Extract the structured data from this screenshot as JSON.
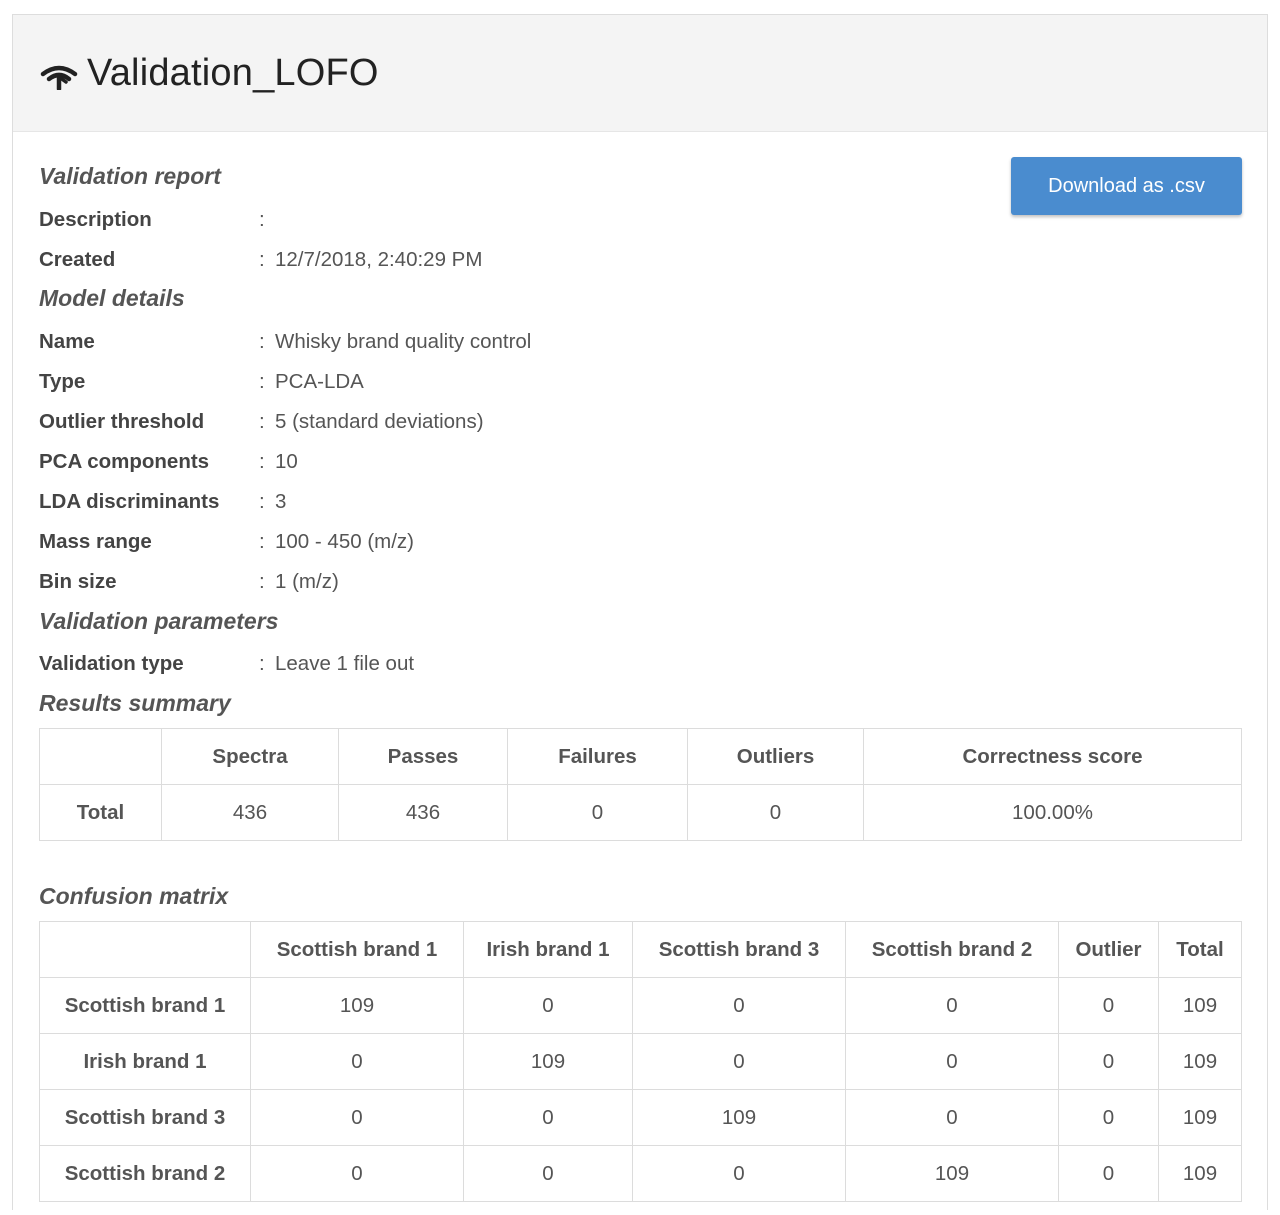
{
  "header": {
    "title": "Validation_LOFO",
    "icon": "wave-icon"
  },
  "actions": {
    "download_label": "Download as .csv",
    "download_color": "#4a8ccf"
  },
  "validation_report": {
    "heading": "Validation report",
    "description_label": "Description",
    "description_value": "",
    "created_label": "Created",
    "created_value": "12/7/2018, 2:40:29 PM"
  },
  "model_details": {
    "heading": "Model details",
    "rows": [
      {
        "label": "Name",
        "value": "Whisky brand quality control"
      },
      {
        "label": "Type",
        "value": "PCA-LDA"
      },
      {
        "label": "Outlier threshold",
        "value": "5 (standard deviations)"
      },
      {
        "label": "PCA components",
        "value": "10"
      },
      {
        "label": "LDA discriminants",
        "value": "3"
      },
      {
        "label": "Mass range",
        "value": "100 - 450 (m/z)"
      },
      {
        "label": "Bin size",
        "value": "1 (m/z)"
      }
    ]
  },
  "validation_parameters": {
    "heading": "Validation parameters",
    "type_label": "Validation type",
    "type_value": "Leave 1 file out"
  },
  "results_summary": {
    "heading": "Results summary",
    "columns": [
      "",
      "Spectra",
      "Passes",
      "Failures",
      "Outliers",
      "Correctness score"
    ],
    "row": [
      "Total",
      "436",
      "436",
      "0",
      "0",
      "100.00%"
    ]
  },
  "confusion_matrix": {
    "heading": "Confusion matrix",
    "columns": [
      "",
      "Scottish brand 1",
      "Irish brand 1",
      "Scottish brand 3",
      "Scottish brand 2",
      "Outlier",
      "Total"
    ],
    "rows": [
      [
        "Scottish brand 1",
        "109",
        "0",
        "0",
        "0",
        "0",
        "109"
      ],
      [
        "Irish brand 1",
        "0",
        "109",
        "0",
        "0",
        "0",
        "109"
      ],
      [
        "Scottish brand 3",
        "0",
        "0",
        "109",
        "0",
        "0",
        "109"
      ],
      [
        "Scottish brand 2",
        "0",
        "0",
        "0",
        "109",
        "0",
        "109"
      ]
    ]
  }
}
